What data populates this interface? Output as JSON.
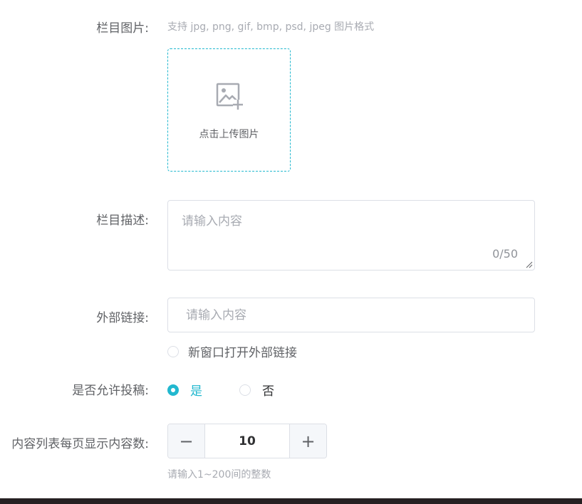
{
  "image_field": {
    "label": "栏目图片:",
    "hint": "支持 jpg, png, gif, bmp, psd, jpeg 图片格式",
    "upload_text": "点击上传图片",
    "upload_icon": "image-plus-icon"
  },
  "description_field": {
    "label": "栏目描述:",
    "placeholder": "请输入内容",
    "value": "",
    "counter": "0/50"
  },
  "link_field": {
    "label": "外部链接:",
    "placeholder": "请输入内容",
    "value": "",
    "new_window_label": "新窗口打开外部链接",
    "new_window_checked": false
  },
  "contribution_field": {
    "label": "是否允许投稿:",
    "options": [
      {
        "label": "是",
        "checked": true
      },
      {
        "label": "否",
        "checked": false
      }
    ]
  },
  "page_size_field": {
    "label": "内容列表每页显示内容数:",
    "value": "10",
    "minus_symbol": "−",
    "plus_symbol": "+",
    "hint": "请输入1~200间的整数"
  },
  "colors": {
    "accent": "#22b8cf",
    "border": "#dcdfe6",
    "text": "#606266",
    "placeholder": "#a8abb2"
  }
}
